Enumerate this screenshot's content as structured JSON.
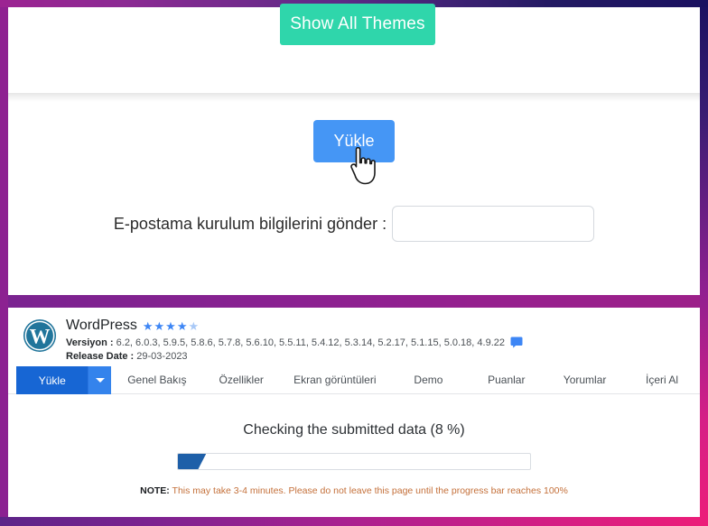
{
  "frame": {
    "border_top_gradient_from": "#9c2392",
    "border_top_gradient_to": "#1a1160",
    "border_bottom_gradient_from": "#5c2488",
    "border_bottom_gradient_to": "#ec1e79",
    "border_left_color": "#8c2191",
    "mid_band_color": "#8a2191"
  },
  "themes": {
    "show_all_label": "Show All Themes",
    "accent": "#2fd6ab"
  },
  "install": {
    "yukle_label": "Yükle",
    "yukle_color": "#4596f5",
    "cursor_icon": "hand-pointer-cursor",
    "email_label": "E-postama kurulum bilgilerini gönder :",
    "email_value": "",
    "email_placeholder": ""
  },
  "product": {
    "logo_icon": "wordpress-logo",
    "name": "WordPress",
    "rating_stars": [
      "full",
      "full",
      "full",
      "full",
      "half"
    ],
    "rating_color": "#3d86f5",
    "version_prefix": "Versiyon :",
    "versions": "6.2, 6.0.3, 5.9.5, 5.8.6, 5.7.8, 5.6.10, 5.5.11, 5.4.12, 5.3.14, 5.2.17, 5.1.15, 5.0.18, 4.9.22",
    "comment_icon": "comment-bubble-icon",
    "release_prefix": "Release Date :",
    "release_date": "29-03-2023"
  },
  "tabs": {
    "active": "Yükle",
    "active_bg": "#1766d4",
    "caret_icon": "chevron-down-icon",
    "items": [
      {
        "label": "Yükle"
      },
      {
        "label": "Genel Bakış"
      },
      {
        "label": "Özellikler"
      },
      {
        "label": "Ekran görüntüleri"
      },
      {
        "label": "Demo"
      },
      {
        "label": "Puanlar"
      },
      {
        "label": "Yorumlar"
      },
      {
        "label": "İçeri Al"
      }
    ]
  },
  "progress": {
    "title": "Checking the submitted data (8 %)",
    "percent": 8,
    "fill_color": "#1e5fa8",
    "note_label": "NOTE:",
    "note_text": " This may take 3-4 minutes. Please do not leave this page until the progress bar reaches 100%"
  }
}
